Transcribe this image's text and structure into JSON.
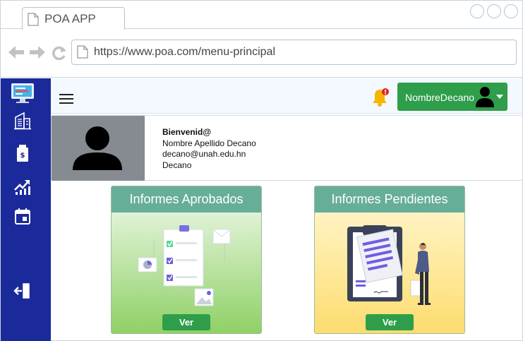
{
  "browser": {
    "tab_title": "POA APP",
    "url": "https://www.poa.com/menu-principal"
  },
  "sidebar": {
    "items": [
      {
        "icon": "dashboard-icon"
      },
      {
        "icon": "building-icon"
      },
      {
        "icon": "budget-document-icon"
      },
      {
        "icon": "trending-chart-icon"
      },
      {
        "icon": "calendar-icon"
      },
      {
        "icon": "logout-icon"
      }
    ]
  },
  "topbar": {
    "user_name": "NombreDecano",
    "notification_badge": "!"
  },
  "profile": {
    "welcome": "Bienvenid@",
    "full_name": "Nombre Apellido Decano",
    "email": "decano@unah.edu.hn",
    "role": "Decano"
  },
  "cards": [
    {
      "title": "Informes Aprobados",
      "button": "Ver"
    },
    {
      "title": "Informes Pendientes",
      "button": "Ver"
    }
  ],
  "colors": {
    "sidebar": "#1b2a9a",
    "accent_green": "#2e9e4a",
    "card_header": "#67ae98"
  }
}
